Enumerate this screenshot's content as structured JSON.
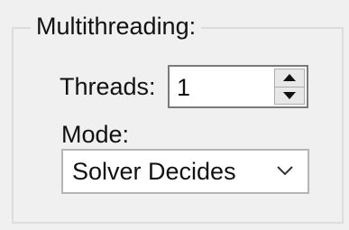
{
  "group": {
    "title": "Multithreading:"
  },
  "threads": {
    "label": "Threads:",
    "value": "1",
    "up_icon": "triangle-up-icon",
    "down_icon": "triangle-down-icon"
  },
  "mode": {
    "label": "Mode:",
    "selected": "Solver Decides",
    "dropdown_icon": "chevron-down-icon"
  },
  "colors": {
    "background": "#f0f0f0",
    "field_background": "#ffffff",
    "field_border": "#7a7a7a",
    "text": "#111111"
  }
}
